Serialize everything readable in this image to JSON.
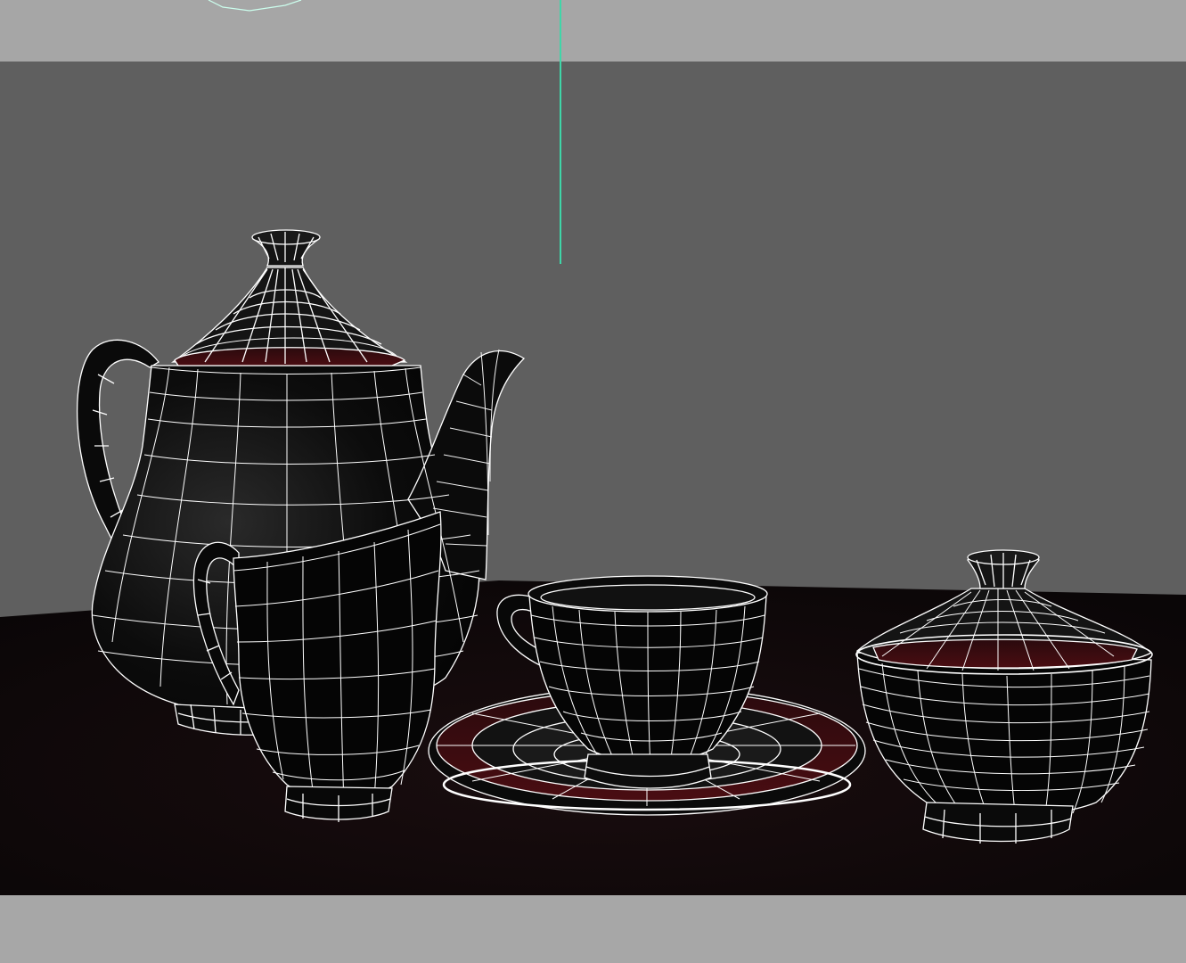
{
  "viewport": {
    "background_wall": "#5f5f5f",
    "table_surface": "#120a0b",
    "frame_color": "#a7a7a7",
    "wire_color": "#ffffff",
    "glaze_color": "#4a0d12",
    "guide_line_color": "#3fd6a8"
  },
  "scene_objects": [
    {
      "name": "teapot",
      "icon": "teapot-wireframe"
    },
    {
      "name": "creamer",
      "icon": "jug-wireframe"
    },
    {
      "name": "teacup",
      "icon": "cup-wireframe"
    },
    {
      "name": "saucer",
      "icon": "plate-wireframe"
    },
    {
      "name": "sugar-bowl",
      "icon": "bowl-wireframe"
    }
  ]
}
